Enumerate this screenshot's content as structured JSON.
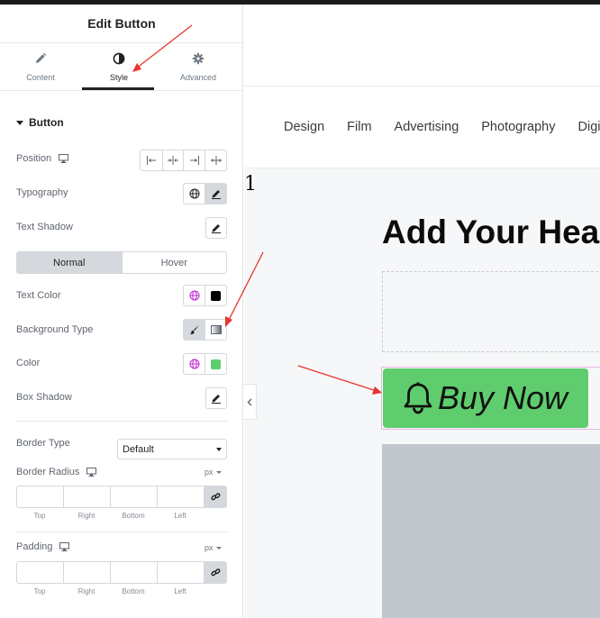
{
  "panel": {
    "title": "Edit Button",
    "tabs": [
      {
        "label": "Content",
        "icon": "pencil-icon"
      },
      {
        "label": "Style",
        "icon": "contrast-icon",
        "active": true
      },
      {
        "label": "Advanced",
        "icon": "gear-icon"
      }
    ],
    "section": "Button",
    "labels": {
      "position": "Position",
      "typography": "Typography",
      "text_shadow": "Text Shadow",
      "text_color": "Text Color",
      "background_type": "Background Type",
      "color": "Color",
      "box_shadow": "Box Shadow",
      "border_type": "Border Type",
      "border_radius": "Border Radius",
      "padding": "Padding"
    },
    "state_toggle": {
      "normal": "Normal",
      "hover": "Hover",
      "active": "Normal"
    },
    "border_type_value": "Default",
    "unit": "px",
    "dimension_labels": [
      "Top",
      "Right",
      "Bottom",
      "Left"
    ],
    "colors": {
      "text_color": "#000000",
      "background_color": "#5fcd6e",
      "global_icon": "#c026d3"
    }
  },
  "preview": {
    "nav": [
      "Design",
      "Film",
      "Advertising",
      "Photography",
      "Digital"
    ],
    "stray_text": "1",
    "heading": "Add Your Heading",
    "button_label": "Buy Now",
    "button_icon": "bell-icon",
    "button_color": "#5fcd6e"
  }
}
